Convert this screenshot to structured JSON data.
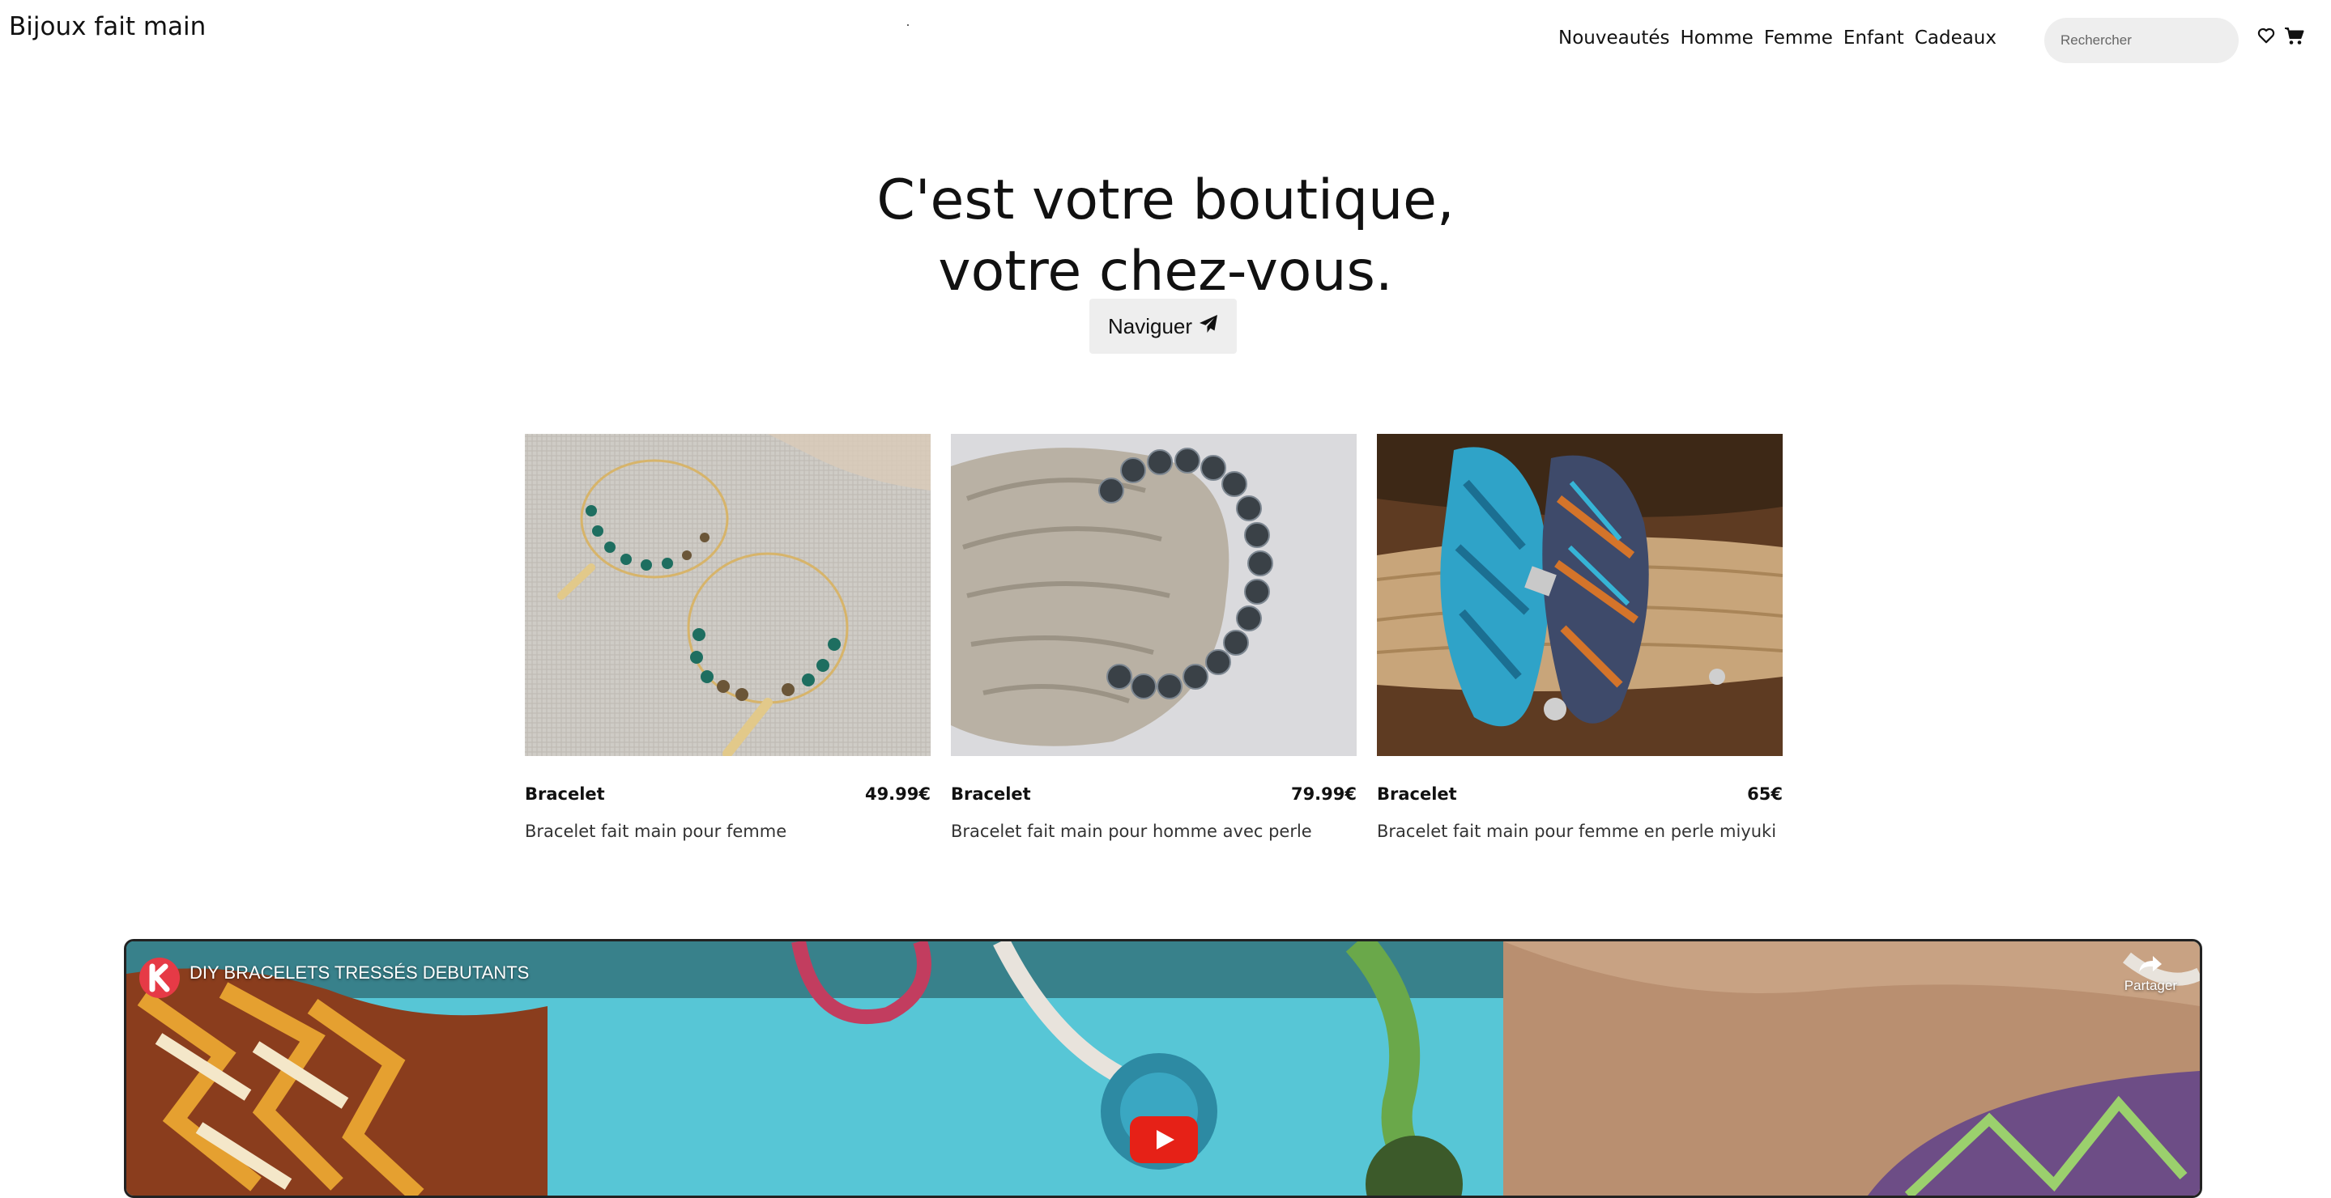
{
  "header": {
    "brand": "Bijoux fait main",
    "nav": [
      "Nouveautés",
      "Homme",
      "Femme",
      "Enfant",
      "Cadeaux"
    ],
    "search_placeholder": "Rechercher",
    "icons": [
      "heart-icon",
      "cart-icon"
    ]
  },
  "hero": {
    "title_line1": "C'est votre boutique,",
    "title_line2": "votre chez-vous.",
    "cta_label": "Naviguer",
    "cta_icon": "paper-plane-icon"
  },
  "products": [
    {
      "name": "Bracelet",
      "price": "49.99€",
      "description": "Bracelet fait main pour femme"
    },
    {
      "name": "Bracelet",
      "price": "79.99€",
      "description": "Bracelet fait main pour homme avec perle"
    },
    {
      "name": "Bracelet",
      "price": "65€",
      "description": "Bracelet fait main pour femme en perle miyuki"
    }
  ],
  "video": {
    "title": "DIY BRACELETS TRESSÉS DEBUTANTS",
    "share_label": "Partager",
    "channel_logo": "K",
    "play_color": "#e62117"
  }
}
